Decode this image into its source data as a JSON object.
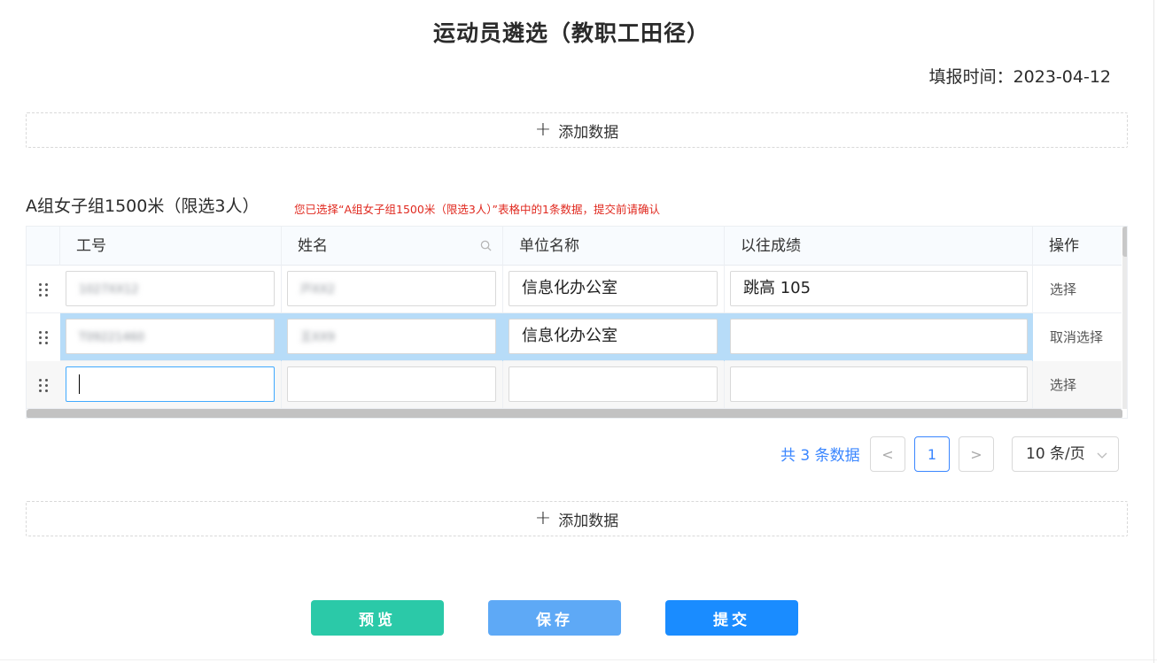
{
  "page": {
    "title": "运动员遴选（教职工田径）",
    "fill_time": "填报时间：2023-04-12"
  },
  "add_button": {
    "icon": "plus-icon",
    "label": "添加数据"
  },
  "section": {
    "title": "A组女子组1500米（限选3人）",
    "note": "您已选择“A组女子组1500米（限选3人）”表格中的1条数据，提交前请确认"
  },
  "table": {
    "columns": [
      "工号",
      "姓名",
      "单位名称",
      "以往成绩",
      "操作"
    ],
    "rows": [
      {
        "id": "1027XX12",
        "name": "戸XX2",
        "unit": "信息化办公室",
        "score": "跳高 105",
        "action": "选择",
        "selected": false
      },
      {
        "id": "T09221460",
        "name": "王XX9",
        "unit": "信息化办公室",
        "score": "",
        "action": "取消选择",
        "selected": true
      },
      {
        "id": "",
        "name": "",
        "unit": "",
        "score": "",
        "action": "选择",
        "selected": false
      }
    ]
  },
  "pagination": {
    "total": "共 3 条数据",
    "prev": "<",
    "current": "1",
    "next": ">",
    "page_size": "10 条/页"
  },
  "actions": {
    "preview": "预览",
    "save": "保存",
    "submit": "提交"
  },
  "colors": {
    "accent": "#3a86ff",
    "preview": "#2bc9a8",
    "save": "#5ea9f6",
    "submit": "#1a8cff",
    "selected_row": "#b7dcf8",
    "note": "#e0291f"
  }
}
